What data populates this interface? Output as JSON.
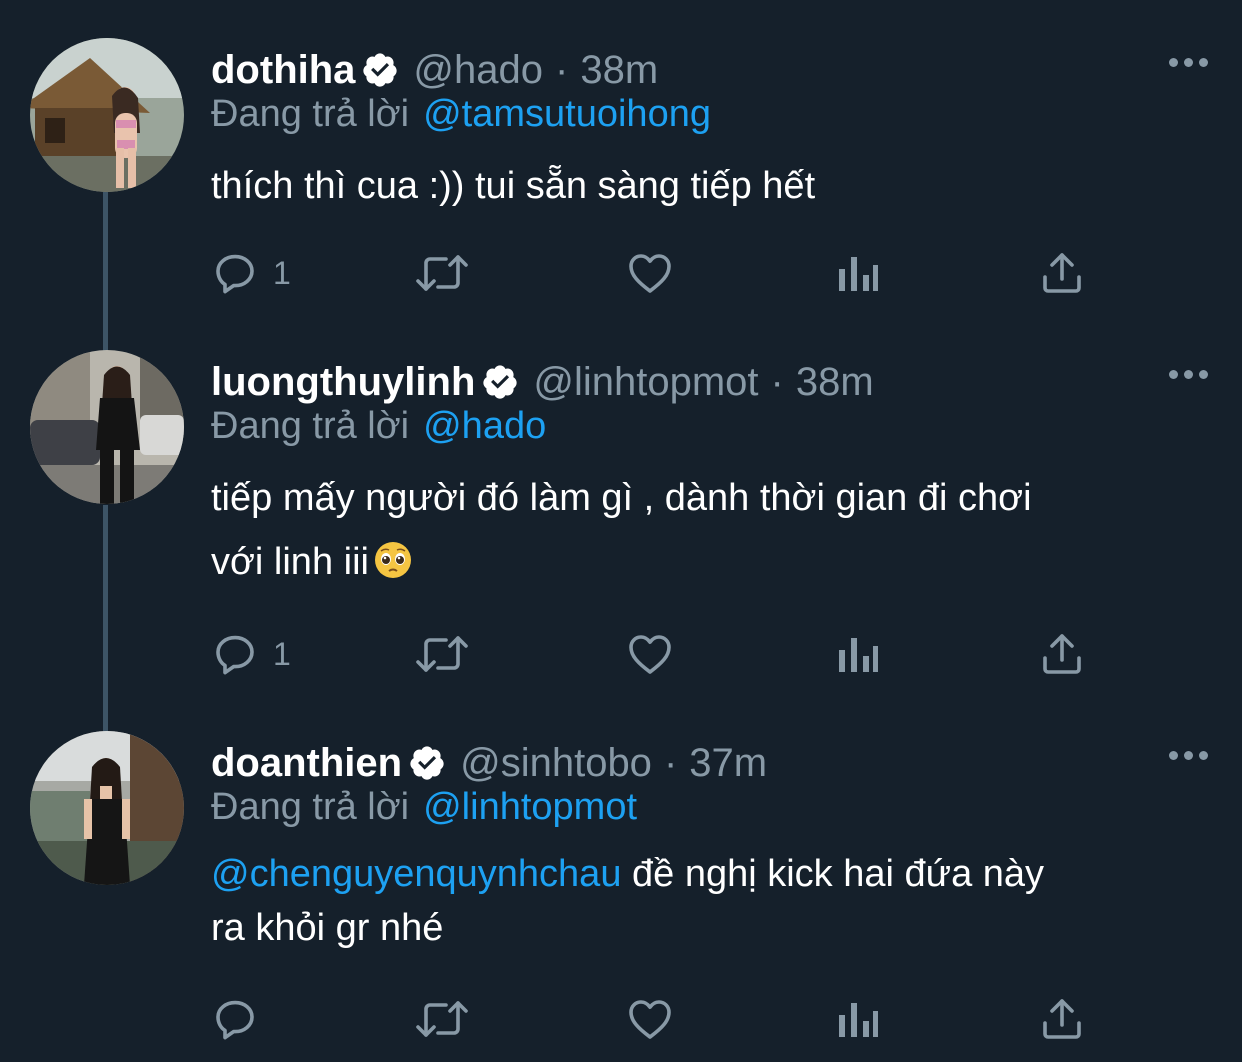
{
  "theme": {
    "background": "#15202b",
    "text": "#ffffff",
    "muted": "#8899a6",
    "accent": "#1da1f2",
    "thread_line": "#3d5466"
  },
  "reply_prefix": "Đang trả lời",
  "tweets": [
    {
      "display_name": "dothiha",
      "verified": true,
      "handle": "@hado",
      "separator": "·",
      "time": "38m",
      "reply_to": "@tamsutuoihong",
      "text": "thích thì cua :)) tui sẵn sàng tiếp hết",
      "reply_count": "1",
      "icons": [
        "reply-icon",
        "retweet-icon",
        "like-icon",
        "analytics-icon",
        "share-icon"
      ]
    },
    {
      "display_name": "luongthuylinh",
      "verified": true,
      "handle": "@linhtopmot",
      "separator": "·",
      "time": "38m",
      "reply_to": "@hado",
      "text_line1": "tiếp mấy người đó làm gì , dành thời gian đi chơi",
      "text_line2": "với linh iii",
      "emoji": "pleading-face-emoji",
      "reply_count": "1",
      "icons": [
        "reply-icon",
        "retweet-icon",
        "like-icon",
        "analytics-icon",
        "share-icon"
      ]
    },
    {
      "display_name": "doanthien",
      "verified": true,
      "handle": "@sinhtobo",
      "separator": "·",
      "time": "37m",
      "reply_to": "@linhtopmot",
      "text_mention": "@chenguyenquynhchau",
      "text_line1_rest": " đề nghị kick hai đứa này",
      "text_line2": "ra khỏi gr nhé",
      "reply_count": "",
      "icons": [
        "reply-icon",
        "retweet-icon",
        "like-icon",
        "analytics-icon",
        "share-icon"
      ]
    }
  ]
}
